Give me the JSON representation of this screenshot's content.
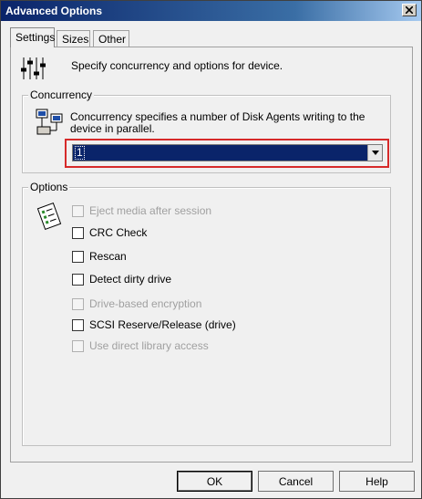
{
  "window": {
    "title": "Advanced Options"
  },
  "tabs": [
    {
      "label": "Settings",
      "active": true
    },
    {
      "label": "Sizes",
      "active": false
    },
    {
      "label": "Other",
      "active": false
    }
  ],
  "settings": {
    "header_text": "Specify concurrency and options for device.",
    "concurrency": {
      "group_label": "Concurrency",
      "description": "Concurrency specifies a number of Disk Agents writing to the device in parallel.",
      "value": "1"
    },
    "options": {
      "group_label": "Options",
      "items": [
        {
          "label": "Eject media after session",
          "checked": false,
          "enabled": false
        },
        {
          "label": "CRC Check",
          "checked": false,
          "enabled": true
        },
        {
          "label": "Rescan",
          "checked": false,
          "enabled": true
        },
        {
          "label": "Detect dirty drive",
          "checked": false,
          "enabled": true
        },
        {
          "label": "Drive-based encryption",
          "checked": false,
          "enabled": false
        },
        {
          "label": "SCSI Reserve/Release (drive)",
          "checked": false,
          "enabled": true
        },
        {
          "label": "Use direct library access",
          "checked": false,
          "enabled": false
        }
      ]
    }
  },
  "buttons": {
    "ok": "OK",
    "cancel": "Cancel",
    "help": "Help"
  },
  "colors": {
    "title_bar": "#0a246a",
    "selection": "#0a246a",
    "highlight_box": "#d62a2a"
  }
}
